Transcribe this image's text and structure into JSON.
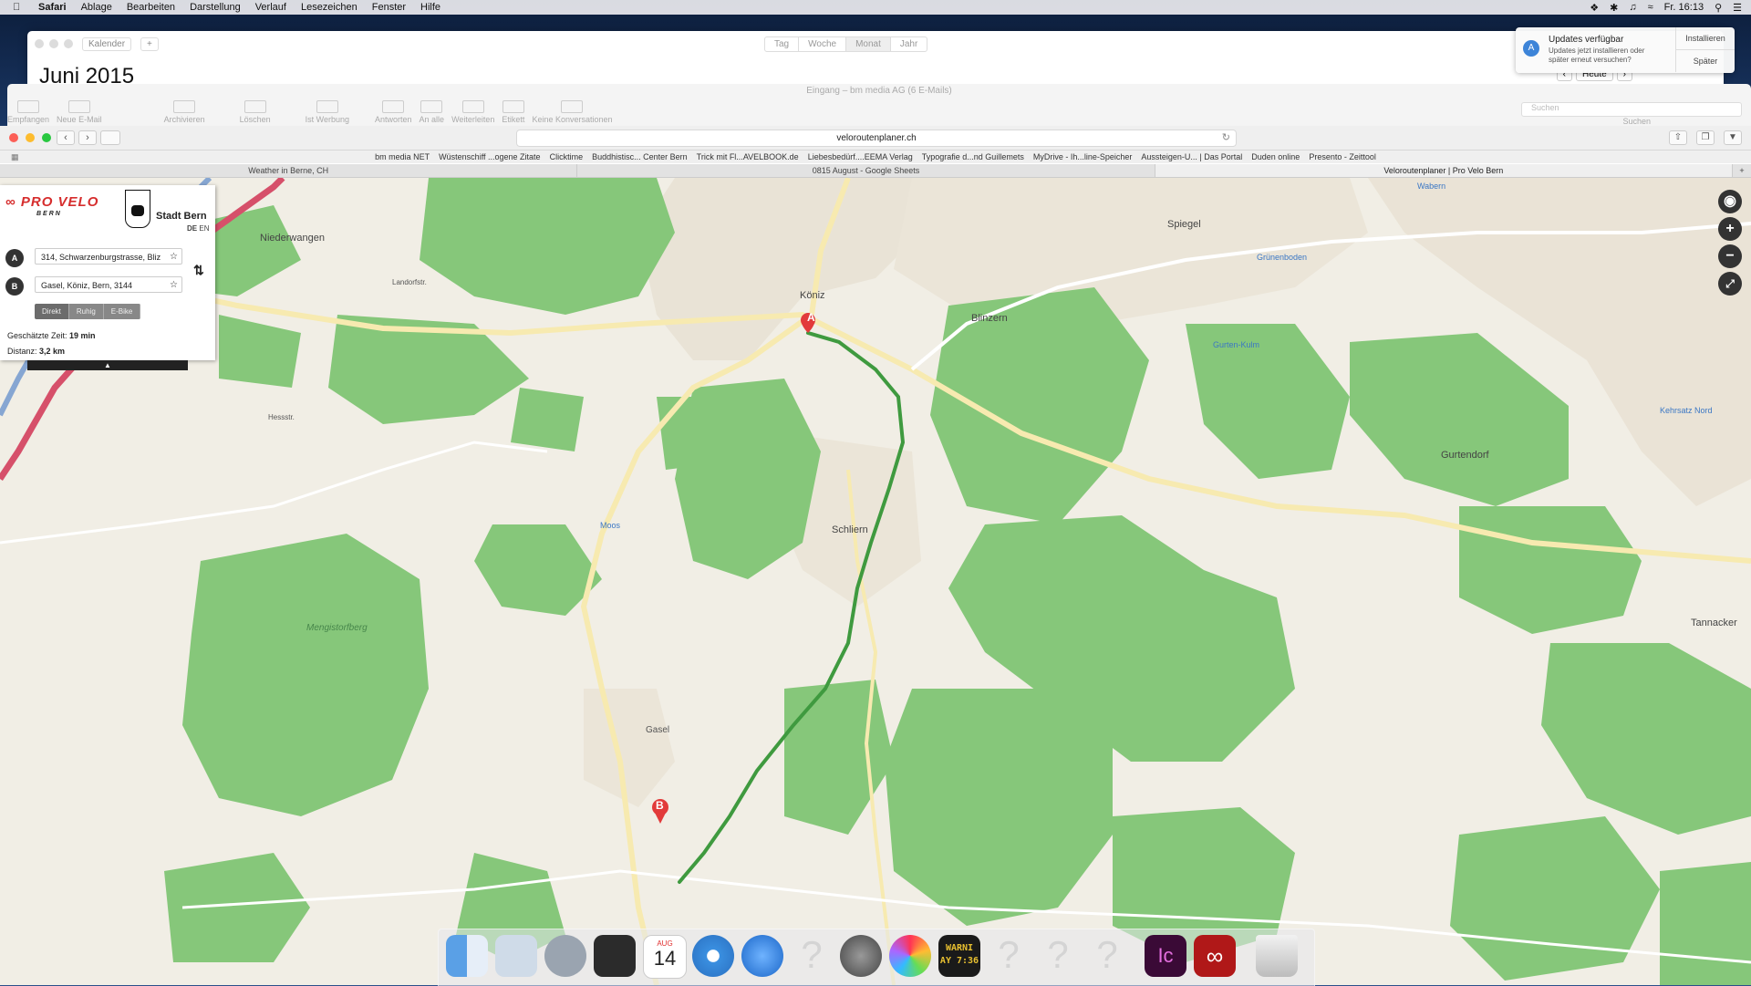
{
  "menubar": {
    "app": "Safari",
    "items": [
      "Ablage",
      "Bearbeiten",
      "Darstellung",
      "Verlauf",
      "Lesezeichen",
      "Fenster",
      "Hilfe"
    ],
    "clock": "Fr. 16:13"
  },
  "calendar": {
    "title_button": "Kalender",
    "views": [
      "Tag",
      "Woche",
      "Monat",
      "Jahr"
    ],
    "selected_view": "Monat",
    "month_title": "Juni 2015",
    "today_label": "Heute"
  },
  "notification": {
    "title": "Updates verfügbar",
    "body": "Updates jetzt installieren oder später erneut versuchen?",
    "install_label": "Installieren",
    "later_label": "Später"
  },
  "mail": {
    "title": "Eingang – bm media AG (6 E-Mails)",
    "tools": [
      "Empfangen",
      "Neue E-Mail",
      "Archivieren",
      "Löschen",
      "Ist Werbung",
      "Antworten",
      "An alle",
      "Weiterleiten",
      "Etikett",
      "Keine Konversationen"
    ],
    "search_placeholder": "Suchen",
    "search_label": "Suchen"
  },
  "safari": {
    "url": "veloroutenplaner.ch",
    "favorites": [
      "bm media NET",
      "Wüstenschiff ...ogene Zitate",
      "Clicktime",
      "Buddhistisc... Center Bern",
      "Trick mit Fl...AVELBOOK.de",
      "Liebesbedürf....EEMA Verlag",
      "Typografie d...nd Guillemets",
      "MyDrive - Ih...line-Speicher",
      "Aussteigen-U... | Das Portal",
      "Duden online",
      "Presento - Zeittool"
    ],
    "tabs": [
      "Weather in Berne, CH",
      "0815 August - Google Sheets",
      "Veloroutenplaner | Pro Velo Bern"
    ],
    "active_tab": 2
  },
  "planner": {
    "logo": "PRO VELO",
    "logo_sub": "BERN",
    "city": "Stadt Bern",
    "lang_de": "DE",
    "lang_en": "EN",
    "from_label": "A",
    "to_label": "B",
    "from_value": "314, Schwarzenburgstrasse, Bliz",
    "to_value": "Gasel, Köniz, Bern, 3144",
    "modes": [
      "Direkt",
      "Ruhig",
      "E-Bike"
    ],
    "selected_mode": "Direkt",
    "time_label": "Geschätzte Zeit:",
    "time_value": "19 min",
    "distance_label": "Distanz:",
    "distance_value": "3,2 km"
  },
  "map": {
    "labels": [
      "Niederwangen",
      "Köniz",
      "Blinzern",
      "Spiegel",
      "Grünenboden",
      "Gurten-Kulm",
      "Schliern",
      "Gurtendorf",
      "Kehrsatz Nord",
      "Tannacker",
      "Mengistorfberg",
      "Wabern",
      "Moos",
      "Gasel",
      "Landorfstr.",
      "Hessstr."
    ],
    "marker_start": "A",
    "marker_end": "B",
    "route_color": "#3f9a3f"
  },
  "dock": {
    "calendar_month": "AUG",
    "calendar_day": "14",
    "console_text": "WARNI AY 7:36",
    "apps": [
      "Finder",
      "Preview",
      "Launchpad",
      "Photo Booth",
      "Calendar",
      "Safari",
      "Mail",
      "System Preferences",
      "Photos",
      "Console",
      "InCopy",
      "Acrobat",
      "Trash"
    ]
  }
}
